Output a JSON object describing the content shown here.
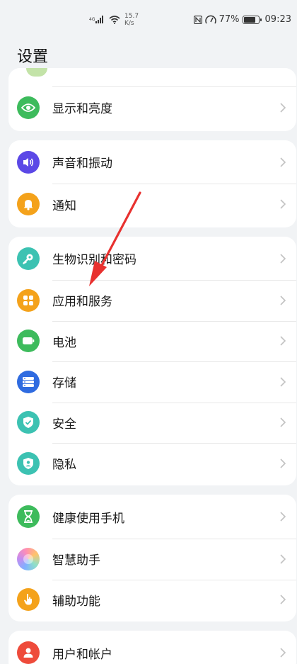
{
  "status_bar": {
    "network": "4G",
    "speed_value": "15.7",
    "speed_unit": "K/s",
    "battery": "77%",
    "time": "09:23"
  },
  "page_title": "设置",
  "groups": [
    {
      "items": [
        {
          "label": "显示和亮度",
          "icon": "eye-icon",
          "color": "#3dbb5c"
        }
      ]
    },
    {
      "items": [
        {
          "label": "声音和振动",
          "icon": "speaker-icon",
          "color": "#5b48e6"
        },
        {
          "label": "通知",
          "icon": "bell-icon",
          "color": "#f4a21b"
        }
      ]
    },
    {
      "items": [
        {
          "label": "生物识别和密码",
          "icon": "key-icon",
          "color": "#3cc2b2"
        },
        {
          "label": "应用和服务",
          "icon": "apps-icon",
          "color": "#f4a21b"
        },
        {
          "label": "电池",
          "icon": "battery-icon",
          "color": "#3dbb5c"
        },
        {
          "label": "存储",
          "icon": "storage-icon",
          "color": "#2f6be0"
        },
        {
          "label": "安全",
          "icon": "shield-icon",
          "color": "#3cc2b2"
        },
        {
          "label": "隐私",
          "icon": "privacy-icon",
          "color": "#3cc2b2"
        }
      ]
    },
    {
      "items": [
        {
          "label": "健康使用手机",
          "icon": "hourglass-icon",
          "color": "#3dbb5c"
        },
        {
          "label": "智慧助手",
          "icon": "assistant-icon",
          "color": "#c8a8f0"
        },
        {
          "label": "辅助功能",
          "icon": "hand-icon",
          "color": "#f4a21b"
        }
      ]
    },
    {
      "items": [
        {
          "label": "用户和帐户",
          "icon": "user-icon",
          "color": "#ee4b3b"
        }
      ]
    }
  ],
  "colors": {
    "annotation_arrow": "#e8312f"
  }
}
